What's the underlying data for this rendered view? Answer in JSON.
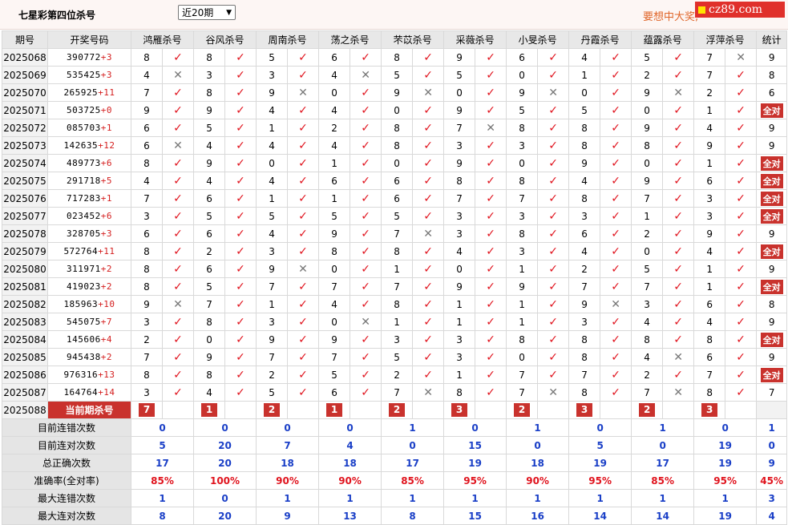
{
  "title": "七星彩第四位杀号",
  "period_select": "近20期",
  "slogan": "要想中大奖,",
  "logo": "cz89.com",
  "headers": {
    "issue": "期号",
    "draw": "开奖号码",
    "count": "统计"
  },
  "experts": [
    "鸿雁杀号",
    "谷风杀号",
    "周南杀号",
    "荡之杀号",
    "芣苡杀号",
    "采薇杀号",
    "小旻杀号",
    "丹霞杀号",
    "蕴露杀号",
    "浮萍杀号"
  ],
  "rows": [
    {
      "issue": "2025068",
      "digits": "390772",
      "plus": "+3",
      "kills": [
        "8",
        "8",
        "5",
        "6",
        "8",
        "9",
        "6",
        "4",
        "5",
        "7"
      ],
      "hits": [
        1,
        1,
        1,
        1,
        1,
        1,
        1,
        1,
        1,
        0
      ],
      "count": "9"
    },
    {
      "issue": "2025069",
      "digits": "535425",
      "plus": "+3",
      "kills": [
        "4",
        "3",
        "3",
        "4",
        "5",
        "5",
        "0",
        "1",
        "2",
        "7"
      ],
      "hits": [
        0,
        1,
        1,
        0,
        1,
        1,
        1,
        1,
        1,
        1
      ],
      "count": "8"
    },
    {
      "issue": "2025070",
      "digits": "265925",
      "plus": "+11",
      "kills": [
        "7",
        "8",
        "9",
        "0",
        "9",
        "0",
        "9",
        "0",
        "9",
        "2"
      ],
      "hits": [
        1,
        1,
        0,
        1,
        0,
        1,
        0,
        1,
        0,
        1
      ],
      "count": "6"
    },
    {
      "issue": "2025071",
      "digits": "503725",
      "plus": "+0",
      "kills": [
        "9",
        "9",
        "4",
        "4",
        "0",
        "9",
        "5",
        "5",
        "0",
        "1"
      ],
      "hits": [
        1,
        1,
        1,
        1,
        1,
        1,
        1,
        1,
        1,
        1
      ],
      "count": "全对"
    },
    {
      "issue": "2025072",
      "digits": "085703",
      "plus": "+1",
      "kills": [
        "6",
        "5",
        "1",
        "2",
        "8",
        "7",
        "8",
        "8",
        "9",
        "4"
      ],
      "hits": [
        1,
        1,
        1,
        1,
        1,
        0,
        1,
        1,
        1,
        1
      ],
      "count": "9"
    },
    {
      "issue": "2025073",
      "digits": "142635",
      "plus": "+12",
      "kills": [
        "6",
        "4",
        "4",
        "4",
        "8",
        "3",
        "3",
        "8",
        "8",
        "9"
      ],
      "hits": [
        0,
        1,
        1,
        1,
        1,
        1,
        1,
        1,
        1,
        1
      ],
      "count": "9"
    },
    {
      "issue": "2025074",
      "digits": "489773",
      "plus": "+6",
      "kills": [
        "8",
        "9",
        "0",
        "1",
        "0",
        "9",
        "0",
        "9",
        "0",
        "1"
      ],
      "hits": [
        1,
        1,
        1,
        1,
        1,
        1,
        1,
        1,
        1,
        1
      ],
      "count": "全对"
    },
    {
      "issue": "2025075",
      "digits": "291718",
      "plus": "+5",
      "kills": [
        "4",
        "4",
        "4",
        "6",
        "6",
        "8",
        "8",
        "4",
        "9",
        "6"
      ],
      "hits": [
        1,
        1,
        1,
        1,
        1,
        1,
        1,
        1,
        1,
        1
      ],
      "count": "全对"
    },
    {
      "issue": "2025076",
      "digits": "717283",
      "plus": "+1",
      "kills": [
        "7",
        "6",
        "1",
        "1",
        "6",
        "7",
        "7",
        "8",
        "7",
        "3"
      ],
      "hits": [
        1,
        1,
        1,
        1,
        1,
        1,
        1,
        1,
        1,
        1
      ],
      "count": "全对"
    },
    {
      "issue": "2025077",
      "digits": "023452",
      "plus": "+6",
      "kills": [
        "3",
        "5",
        "5",
        "5",
        "5",
        "3",
        "3",
        "3",
        "1",
        "3"
      ],
      "hits": [
        1,
        1,
        1,
        1,
        1,
        1,
        1,
        1,
        1,
        1
      ],
      "count": "全对"
    },
    {
      "issue": "2025078",
      "digits": "328705",
      "plus": "+3",
      "kills": [
        "6",
        "6",
        "4",
        "9",
        "7",
        "3",
        "8",
        "6",
        "2",
        "9"
      ],
      "hits": [
        1,
        1,
        1,
        1,
        0,
        1,
        1,
        1,
        1,
        1
      ],
      "count": "9"
    },
    {
      "issue": "2025079",
      "digits": "572764",
      "plus": "+11",
      "kills": [
        "8",
        "2",
        "3",
        "8",
        "8",
        "4",
        "3",
        "4",
        "0",
        "4"
      ],
      "hits": [
        1,
        1,
        1,
        1,
        1,
        1,
        1,
        1,
        1,
        1
      ],
      "count": "全对"
    },
    {
      "issue": "2025080",
      "digits": "311971",
      "plus": "+2",
      "kills": [
        "8",
        "6",
        "9",
        "0",
        "1",
        "0",
        "1",
        "2",
        "5",
        "1"
      ],
      "hits": [
        1,
        1,
        0,
        1,
        1,
        1,
        1,
        1,
        1,
        1
      ],
      "count": "9"
    },
    {
      "issue": "2025081",
      "digits": "419023",
      "plus": "+2",
      "kills": [
        "8",
        "5",
        "7",
        "7",
        "7",
        "9",
        "9",
        "7",
        "7",
        "1"
      ],
      "hits": [
        1,
        1,
        1,
        1,
        1,
        1,
        1,
        1,
        1,
        1
      ],
      "count": "全对"
    },
    {
      "issue": "2025082",
      "digits": "185963",
      "plus": "+10",
      "kills": [
        "9",
        "7",
        "1",
        "4",
        "8",
        "1",
        "1",
        "9",
        "3",
        "6"
      ],
      "hits": [
        0,
        1,
        1,
        1,
        1,
        1,
        1,
        0,
        1,
        1
      ],
      "count": "8"
    },
    {
      "issue": "2025083",
      "digits": "545075",
      "plus": "+7",
      "kills": [
        "3",
        "8",
        "3",
        "0",
        "1",
        "1",
        "1",
        "3",
        "4",
        "4"
      ],
      "hits": [
        1,
        1,
        1,
        0,
        1,
        1,
        1,
        1,
        1,
        1
      ],
      "count": "9"
    },
    {
      "issue": "2025084",
      "digits": "145606",
      "plus": "+4",
      "kills": [
        "2",
        "0",
        "9",
        "9",
        "3",
        "3",
        "8",
        "8",
        "8",
        "8"
      ],
      "hits": [
        1,
        1,
        1,
        1,
        1,
        1,
        1,
        1,
        1,
        1
      ],
      "count": "全对"
    },
    {
      "issue": "2025085",
      "digits": "945438",
      "plus": "+2",
      "kills": [
        "7",
        "9",
        "7",
        "7",
        "5",
        "3",
        "0",
        "8",
        "4",
        "6"
      ],
      "hits": [
        1,
        1,
        1,
        1,
        1,
        1,
        1,
        1,
        0,
        1
      ],
      "count": "9"
    },
    {
      "issue": "2025086",
      "digits": "976316",
      "plus": "+13",
      "kills": [
        "8",
        "8",
        "2",
        "5",
        "2",
        "1",
        "7",
        "7",
        "2",
        "7"
      ],
      "hits": [
        1,
        1,
        1,
        1,
        1,
        1,
        1,
        1,
        1,
        1
      ],
      "count": "全对"
    },
    {
      "issue": "2025087",
      "digits": "164764",
      "plus": "+14",
      "kills": [
        "3",
        "4",
        "5",
        "6",
        "7",
        "8",
        "7",
        "8",
        "7",
        "8"
      ],
      "hits": [
        1,
        1,
        1,
        1,
        0,
        1,
        0,
        1,
        0,
        1
      ],
      "count": "7"
    }
  ],
  "current": {
    "issue": "2025088",
    "label": "当前期杀号",
    "kills": [
      "7",
      "1",
      "2",
      "1",
      "2",
      "3",
      "2",
      "3",
      "2",
      "3"
    ]
  },
  "stats": [
    {
      "label": "目前连错次数",
      "values": [
        "0",
        "0",
        "0",
        "0",
        "1",
        "0",
        "1",
        "0",
        "1",
        "0"
      ],
      "total": "1",
      "type": "blue"
    },
    {
      "label": "目前连对次数",
      "values": [
        "5",
        "20",
        "7",
        "4",
        "0",
        "15",
        "0",
        "5",
        "0",
        "19"
      ],
      "total": "0",
      "type": "blue"
    },
    {
      "label": "总正确次数",
      "values": [
        "17",
        "20",
        "18",
        "18",
        "17",
        "19",
        "18",
        "19",
        "17",
        "19"
      ],
      "total": "9",
      "type": "blue"
    },
    {
      "label": "准确率(全对率)",
      "values": [
        "85%",
        "100%",
        "90%",
        "90%",
        "85%",
        "95%",
        "90%",
        "95%",
        "85%",
        "95%"
      ],
      "total": "45%",
      "type": "red"
    },
    {
      "label": "最大连错次数",
      "values": [
        "1",
        "0",
        "1",
        "1",
        "1",
        "1",
        "1",
        "1",
        "1",
        "1"
      ],
      "total": "3",
      "type": "blue"
    },
    {
      "label": "最大连对次数",
      "values": [
        "8",
        "20",
        "9",
        "13",
        "8",
        "15",
        "16",
        "14",
        "14",
        "19"
      ],
      "total": "4",
      "type": "blue"
    }
  ],
  "marks": {
    "hit": "✓",
    "miss": "✕"
  },
  "colors": {
    "hit": "#e0141e",
    "miss": "#777777",
    "accent": "#c9322d",
    "stat_blue": "#1a3fc7",
    "slogan": "#e0662a"
  }
}
